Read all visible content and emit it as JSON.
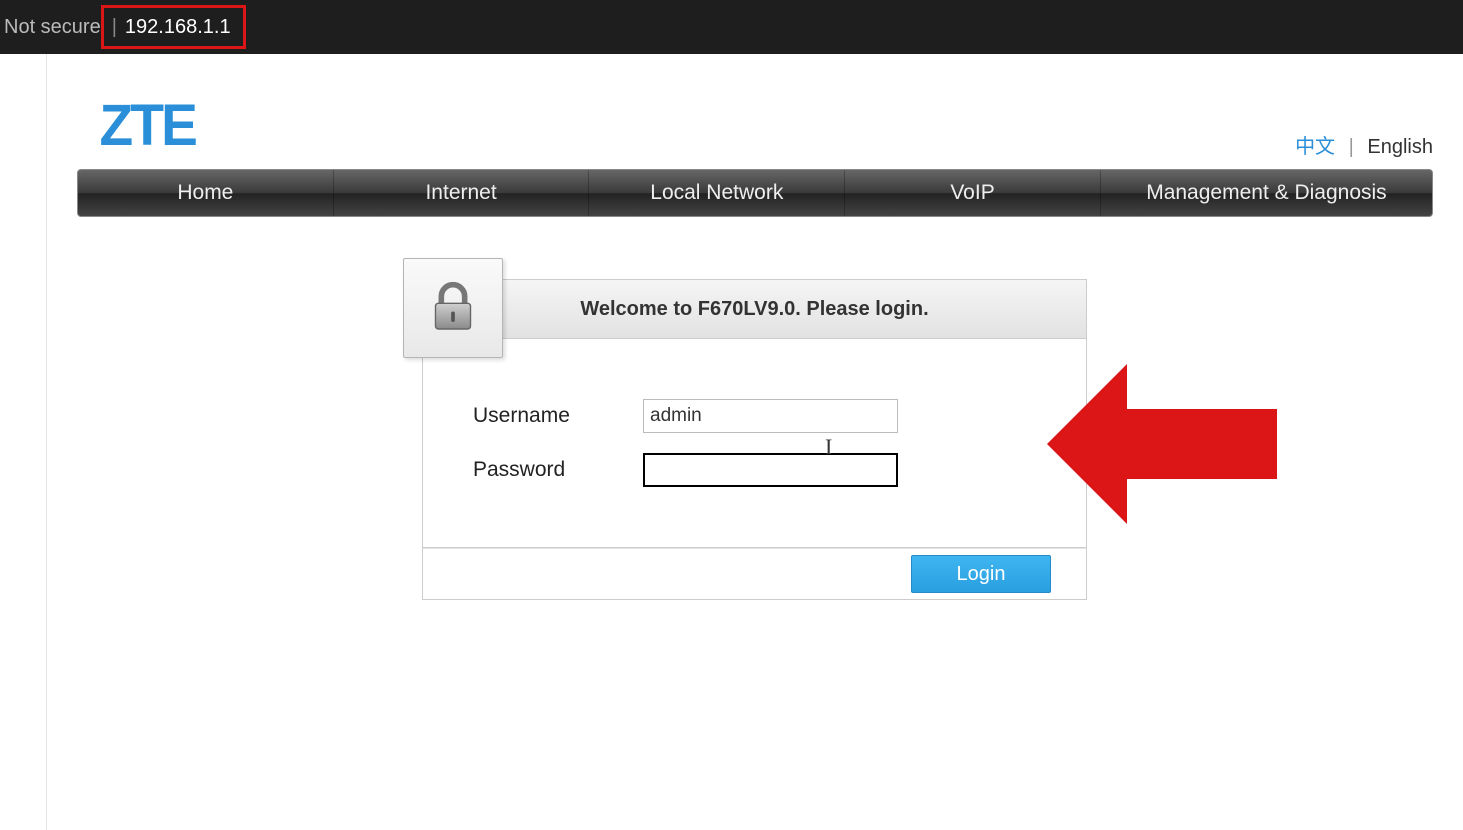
{
  "browser": {
    "security_label": "Not secure",
    "address": "192.168.1.1"
  },
  "brand": "ZTE",
  "lang": {
    "cn": "中文",
    "en": "English"
  },
  "nav": {
    "items": [
      "Home",
      "Internet",
      "Local Network",
      "VoIP",
      "Management & Diagnosis"
    ]
  },
  "login": {
    "welcome": "Welcome to F670LV9.0. Please login.",
    "username_label": "Username",
    "password_label": "Password",
    "username_value": "admin",
    "password_value": "",
    "button": "Login"
  },
  "icons": {
    "lock": "lock-icon"
  },
  "annotation": {
    "arrow_color": "#dc1616"
  }
}
